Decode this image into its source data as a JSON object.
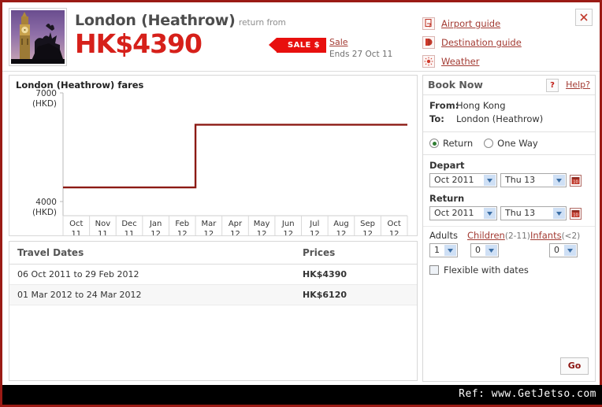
{
  "header": {
    "destination": "London (Heathrow)",
    "return_from": "return from",
    "price": "HK$4390",
    "sale_tag": "SALE $",
    "sale_link": "Sale",
    "sale_ends": "Ends 27 Oct 11",
    "close_icon": "close-icon",
    "thumbnail_alt": "big-ben-photo",
    "guides": [
      {
        "label": "Airport guide",
        "icon": "airport-guide-icon"
      },
      {
        "label": "Destination guide",
        "icon": "destination-guide-icon"
      },
      {
        "label": "Weather",
        "icon": "weather-sun-icon"
      }
    ]
  },
  "chart_data": {
    "type": "line",
    "title": "London (Heathrow) fares",
    "xlabel": "",
    "ylabel": "(HKD)",
    "ylim": [
      4000,
      7000
    ],
    "ytick_labels": [
      "7000",
      "4000"
    ],
    "yaxis_unit": "(HKD)",
    "categories": [
      "Oct 11",
      "Nov 11",
      "Dec 11",
      "Jan 12",
      "Feb 12",
      "Mar 12",
      "Apr 12",
      "May 12",
      "Jun 12",
      "Jul 12",
      "Aug 12",
      "Sep 12",
      "Oct 12"
    ],
    "category_lines": [
      [
        "Oct",
        "11"
      ],
      [
        "Nov",
        "11"
      ],
      [
        "Dec",
        "11"
      ],
      [
        "Jan",
        "12"
      ],
      [
        "Feb",
        "12"
      ],
      [
        "Mar",
        "12"
      ],
      [
        "Apr",
        "12"
      ],
      [
        "May",
        "12"
      ],
      [
        "Jun",
        "12"
      ],
      [
        "Jul",
        "12"
      ],
      [
        "Aug",
        "12"
      ],
      [
        "Sep",
        "12"
      ],
      [
        "Oct",
        "12"
      ]
    ],
    "series": [
      {
        "name": "London (Heathrow) fare",
        "color": "#8c1a14",
        "step": true,
        "values": [
          4390,
          4390,
          4390,
          4390,
          4390,
          6120,
          6120,
          6120,
          6120,
          6120,
          6120,
          6120,
          6120
        ]
      }
    ],
    "grid": false,
    "legend": "none"
  },
  "fares_table": {
    "columns": [
      "Travel Dates",
      "Prices"
    ],
    "rows": [
      {
        "dates": "06 Oct 2011 to 29 Feb 2012",
        "price": "HK$4390"
      },
      {
        "dates": "01 Mar 2012 to 24 Mar 2012",
        "price": "HK$6120"
      }
    ]
  },
  "booking": {
    "title": "Book Now",
    "help_icon_label": "?",
    "help_label": "Help?",
    "from_label": "From:",
    "from_value": "Hong Kong",
    "to_label": "To:",
    "to_value": "London (Heathrow)",
    "trip_return": "Return",
    "trip_oneway": "One Way",
    "depart_label": "Depart",
    "depart_month": "Oct 2011",
    "depart_day": "Thu 13",
    "return_label": "Return",
    "return_month": "Oct 2011",
    "return_day": "Thu 13",
    "adults_label": "Adults",
    "adults_value": "1",
    "children_label": "Children",
    "children_range": "(2-11)",
    "children_value": "0",
    "infants_label": "Infants",
    "infants_range": "(<2)",
    "infants_value": "0",
    "flexible_label": "Flexible with dates",
    "go_label": "Go",
    "calendar_icon_label": "10"
  },
  "footer": {
    "ref_text": "Ref: www.GetJetso.com"
  },
  "colors": {
    "brand_red": "#9b1b15",
    "price_red": "#d6201a",
    "sale_red": "#e8100e",
    "link_red": "#a33b33",
    "chart_line": "#8c1a14"
  }
}
